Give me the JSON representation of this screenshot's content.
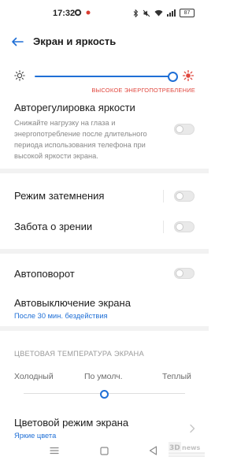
{
  "status_bar": {
    "time": "17:32",
    "battery": "87"
  },
  "header": {
    "title": "Экран и яркость"
  },
  "brightness": {
    "level_fraction": 0.97,
    "warning": "ВЫСОКОЕ ЭНЕРГОПОТРЕБЛЕНИЕ"
  },
  "auto_brightness": {
    "title": "Авторегулировка яркости",
    "description": "Снижайте нагрузку на глаза и энергопотребление после длительного периода использования телефона при высокой яркости экрана.",
    "enabled": false
  },
  "dark_mode": {
    "title": "Режим затемнения",
    "enabled": false
  },
  "eye_care": {
    "title": "Забота о зрении",
    "enabled": false
  },
  "auto_rotate": {
    "title": "Автоповорот",
    "enabled": false
  },
  "screen_timeout": {
    "title": "Автовыключение экрана",
    "value": "После 30 мин. бездействия"
  },
  "color_temperature": {
    "section_title": "ЦВЕТОВАЯ ТЕМПЕРАТУРА ЭКРАНА",
    "cold_label": "Холодный",
    "default_label": "По умолч.",
    "warm_label": "Теплый",
    "level_fraction": 0.5
  },
  "color_mode": {
    "title": "Цветовой режим экрана",
    "value": "Яркие цвета"
  },
  "colors": {
    "accent": "#1f6fd6",
    "warning": "#e0463d"
  }
}
